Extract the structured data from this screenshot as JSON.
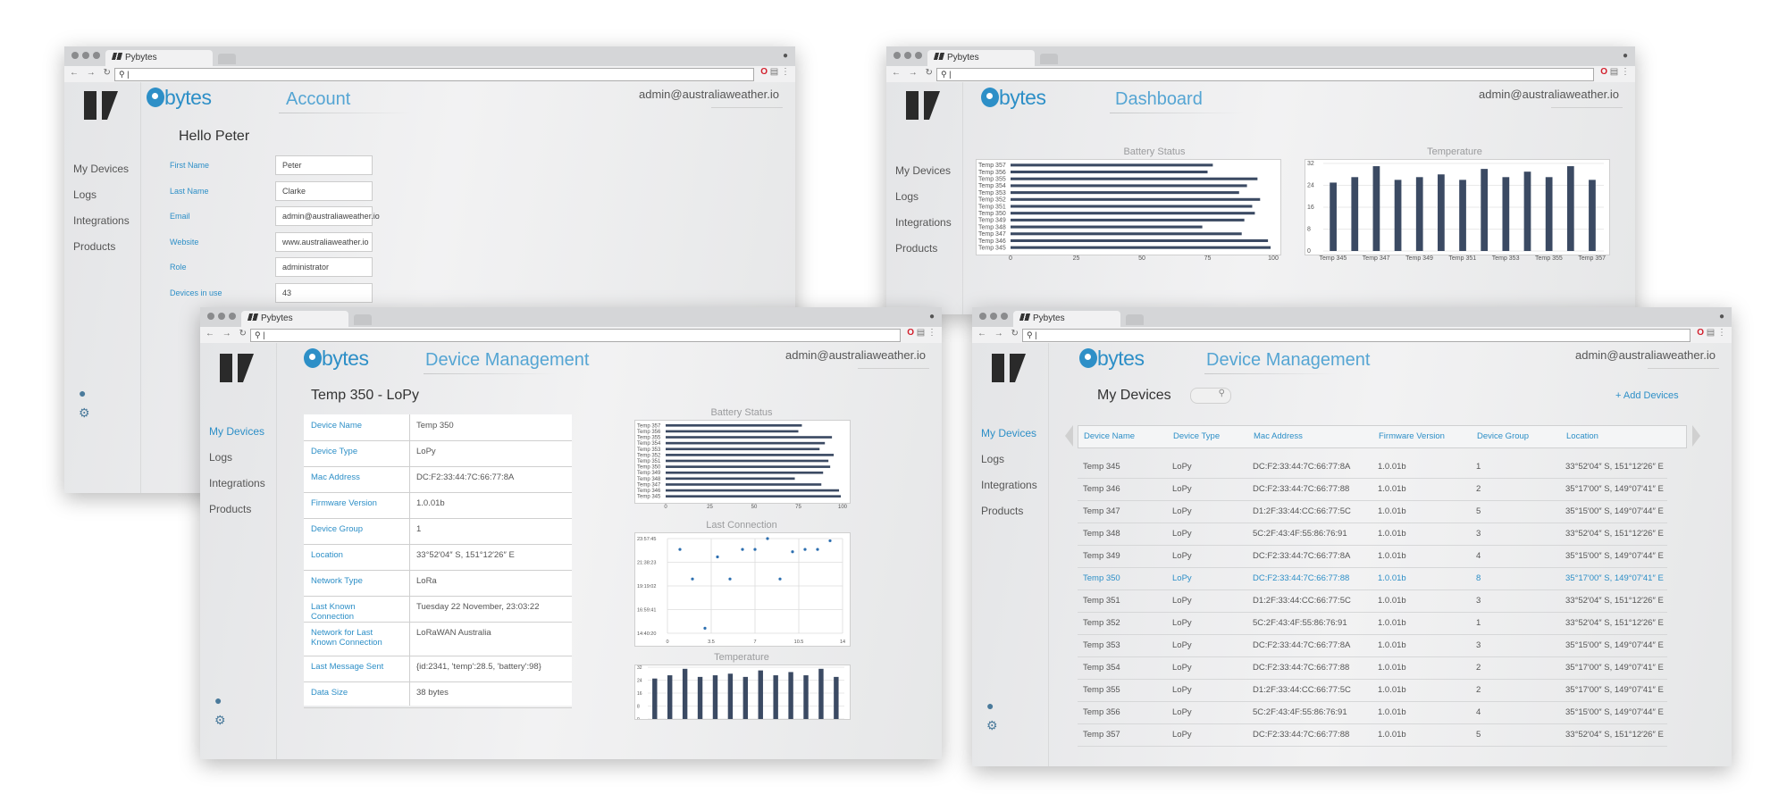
{
  "common": {
    "tab_title": "Pybytes",
    "url_text": "|",
    "brand": "bytes",
    "email": "admin@australiaweather.io",
    "menu": [
      "My Devices",
      "Logs",
      "Integrations",
      "Products"
    ],
    "accent": "#2d8fc7",
    "bar_color": "#3b4a63"
  },
  "account": {
    "title": "Account",
    "heading": "Hello Peter",
    "fields": [
      {
        "label": "First Name",
        "value": "Peter"
      },
      {
        "label": "Last Name",
        "value": "Clarke"
      },
      {
        "label": "Email",
        "value": "admin@australiaweather.io"
      },
      {
        "label": "Website",
        "value": "www.australiaweather.io"
      },
      {
        "label": "Role",
        "value": "administrator"
      },
      {
        "label": "Devices in use",
        "value": "43"
      }
    ]
  },
  "dashboard": {
    "title": "Dashboard",
    "battery_title": "Battery Status",
    "temperature_title": "Temperature"
  },
  "detail": {
    "title": "Device Management",
    "heading": "Temp 350 - LoPy",
    "rows": [
      {
        "label": "Device Name",
        "value": "Temp 350"
      },
      {
        "label": "Device Type",
        "value": "LoPy"
      },
      {
        "label": "Mac Address",
        "value": "DC:F2:33:44:7C:66:77:8A"
      },
      {
        "label": "Firmware Version",
        "value": "1.0.01b"
      },
      {
        "label": "Device Group",
        "value": "1"
      },
      {
        "label": "Location",
        "value": "33°52′04″ S, 151°12′26″ E"
      },
      {
        "label": "Network Type",
        "value": "LoRa"
      },
      {
        "label": "Last Known Connection",
        "value": "Tuesday 22 November, 23:03:22"
      },
      {
        "label": "Network for Last Known Connection",
        "value": "LoRaWAN Australia"
      },
      {
        "label": "Last Message Sent",
        "value": "{id:2341, 'temp':28.5, 'battery':98}"
      },
      {
        "label": "Data Size",
        "value": "38 bytes"
      }
    ],
    "battery_title": "Battery Status",
    "connection_title": "Last Connection",
    "temperature_title": "Temperature"
  },
  "list": {
    "title": "Device Management",
    "heading": "My Devices",
    "add_label": "+ Add Devices",
    "columns": [
      "Device Name",
      "Device Type",
      "Mac Address",
      "Firmware Version",
      "Device Group",
      "Location"
    ],
    "rows": [
      [
        "Temp 345",
        "LoPy",
        "DC:F2:33:44:7C:66:77:8A",
        "1.0.01b",
        "1",
        "33°52′04″ S, 151°12′26″ E"
      ],
      [
        "Temp 346",
        "LoPy",
        "DC:F2:33:44:7C:66:77:88",
        "1.0.01b",
        "2",
        "35°17′00″ S, 149°07′41″ E"
      ],
      [
        "Temp 347",
        "LoPy",
        "D1:2F:33:44:CC:66:77:5C",
        "1.0.01b",
        "5",
        "35°15′00″ S, 149°07′44″ E"
      ],
      [
        "Temp 348",
        "LoPy",
        "5C:2F:43:4F:55:86:76:91",
        "1.0.01b",
        "3",
        "33°52′04″ S, 151°12′26″ E"
      ],
      [
        "Temp 349",
        "LoPy",
        "DC:F2:33:44:7C:66:77:8A",
        "1.0.01b",
        "4",
        "35°15′00″ S, 149°07′44″ E"
      ],
      [
        "Temp 350",
        "LoPy",
        "DC:F2:33:44:7C:66:77:88",
        "1.0.01b",
        "8",
        "35°17′00″ S, 149°07′41″ E"
      ],
      [
        "Temp 351",
        "LoPy",
        "D1:2F:33:44:CC:66:77:5C",
        "1.0.01b",
        "3",
        "33°52′04″ S, 151°12′26″ E"
      ],
      [
        "Temp 352",
        "LoPy",
        "5C:2F:43:4F:55:86:76:91",
        "1.0.01b",
        "1",
        "33°52′04″ S, 151°12′26″ E"
      ],
      [
        "Temp 353",
        "LoPy",
        "DC:F2:33:44:7C:66:77:8A",
        "1.0.01b",
        "3",
        "35°15′00″ S, 149°07′44″ E"
      ],
      [
        "Temp 354",
        "LoPy",
        "DC:F2:33:44:7C:66:77:88",
        "1.0.01b",
        "2",
        "35°17′00″ S, 149°07′41″ E"
      ],
      [
        "Temp 355",
        "LoPy",
        "D1:2F:33:44:CC:66:77:5C",
        "1.0.01b",
        "2",
        "35°17′00″ S, 149°07′41″ E"
      ],
      [
        "Temp 356",
        "LoPy",
        "5C:2F:43:4F:55:86:76:91",
        "1.0.01b",
        "4",
        "35°15′00″ S, 149°07′44″ E"
      ],
      [
        "Temp 357",
        "LoPy",
        "DC:F2:33:44:7C:66:77:88",
        "1.0.01b",
        "5",
        "33°52′04″ S, 151°12′26″ E"
      ]
    ],
    "highlight_row": 5
  },
  "chart_data": [
    {
      "type": "bar",
      "orientation": "horizontal",
      "title": "Battery Status",
      "categories": [
        "Temp 357",
        "Temp 356",
        "Temp 355",
        "Temp 354",
        "Temp 353",
        "Temp 352",
        "Temp 351",
        "Temp 350",
        "Temp 349",
        "Temp 348",
        "Temp 347",
        "Temp 346",
        "Temp 345"
      ],
      "values": [
        77,
        75,
        94,
        90,
        87,
        95,
        92,
        93,
        89,
        73,
        88,
        98,
        99
      ],
      "xlim": [
        0,
        100
      ],
      "xticks": [
        "0",
        "25",
        "50",
        "75",
        "100"
      ]
    },
    {
      "type": "bar",
      "title": "Temperature",
      "categories": [
        "Temp 345",
        "Temp 346",
        "Temp 347",
        "Temp 348",
        "Temp 349",
        "Temp 350",
        "Temp 351",
        "Temp 352",
        "Temp 353",
        "Temp 354",
        "Temp 355",
        "Temp 356",
        "Temp 357"
      ],
      "values": [
        25,
        27,
        31,
        26,
        27,
        28,
        26,
        30,
        27,
        29,
        27,
        31,
        26
      ],
      "ylim": [
        0,
        32
      ],
      "yticks": [
        "0",
        "8",
        "16",
        "24",
        "32"
      ],
      "xticks": [
        "Temp 345",
        "Temp 347",
        "Temp 349",
        "Temp 351",
        "Temp 353",
        "Temp 355",
        "Temp 357"
      ]
    },
    {
      "type": "scatter",
      "title": "Last Connection",
      "x": [
        1,
        2,
        3,
        4,
        5,
        6,
        7,
        8,
        9,
        10,
        11,
        12,
        13
      ],
      "y": [
        "22:54:00",
        "20:00:00",
        "15:10:00",
        "22:10:00",
        "20:00:00",
        "22:54:00",
        "22:54:00",
        "23:57:45",
        "20:00:00",
        "22:40:00",
        "22:54:00",
        "22:54:00",
        "23:45:00"
      ],
      "yticks": [
        "23:57:45",
        "21:38:23",
        "19:19:02",
        "16:59:41",
        "14:40:20"
      ],
      "xticks": [
        "0",
        "3.5",
        "7",
        "10.5",
        "14"
      ],
      "xlim": [
        0,
        14
      ]
    }
  ]
}
